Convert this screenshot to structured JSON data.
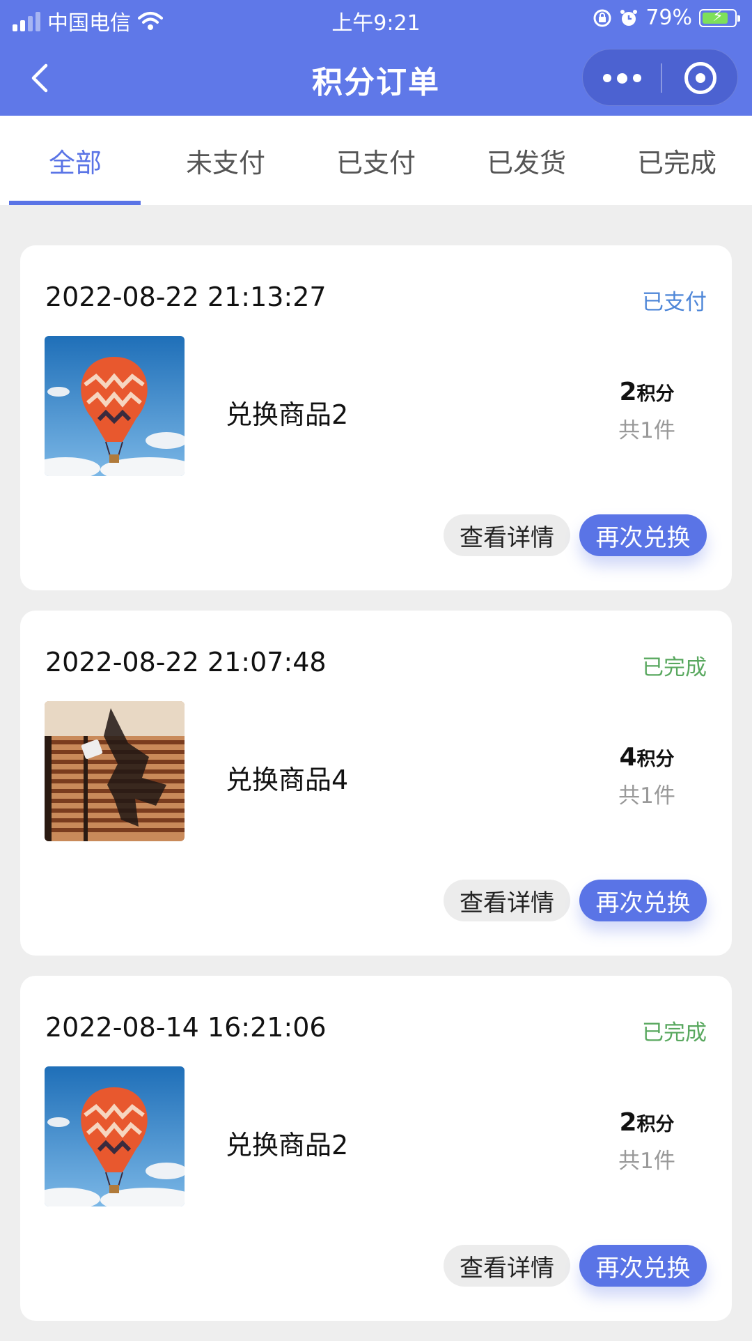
{
  "status_bar": {
    "carrier": "中国电信",
    "time": "上午9:21",
    "battery": "79%",
    "battery_level": 0.79
  },
  "nav": {
    "title": "积分订单",
    "back_icon": "chevron-left-icon",
    "more_icon": "more-dots-icon",
    "close_icon": "target-circle-icon"
  },
  "tabs": [
    {
      "label": "全部",
      "active": true
    },
    {
      "label": "未支付",
      "active": false
    },
    {
      "label": "已支付",
      "active": false
    },
    {
      "label": "已发货",
      "active": false
    },
    {
      "label": "已完成",
      "active": false
    }
  ],
  "colors": {
    "brand": "#5f78e8",
    "accent": "#5a74e6",
    "status_paid": "#4f87d8",
    "status_done": "#59a85f"
  },
  "orders": [
    {
      "time": "2022-08-22 21:13:27",
      "status": "已支付",
      "product": "兑换商品2",
      "image": "hot-air-balloon",
      "points": "2",
      "points_unit": "积分",
      "quantity": "共1件",
      "detail_label": "查看详情",
      "redeem_label": "再次兑换"
    },
    {
      "time": "2022-08-22 21:07:48",
      "status": "已完成",
      "product": "兑换商品4",
      "image": "window-blinds-shadow",
      "points": "4",
      "points_unit": "积分",
      "quantity": "共1件",
      "detail_label": "查看详情",
      "redeem_label": "再次兑换"
    },
    {
      "time": "2022-08-14 16:21:06",
      "status": "已完成",
      "product": "兑换商品2",
      "image": "hot-air-balloon",
      "points": "2",
      "points_unit": "积分",
      "quantity": "共1件",
      "detail_label": "查看详情",
      "redeem_label": "再次兑换"
    }
  ]
}
